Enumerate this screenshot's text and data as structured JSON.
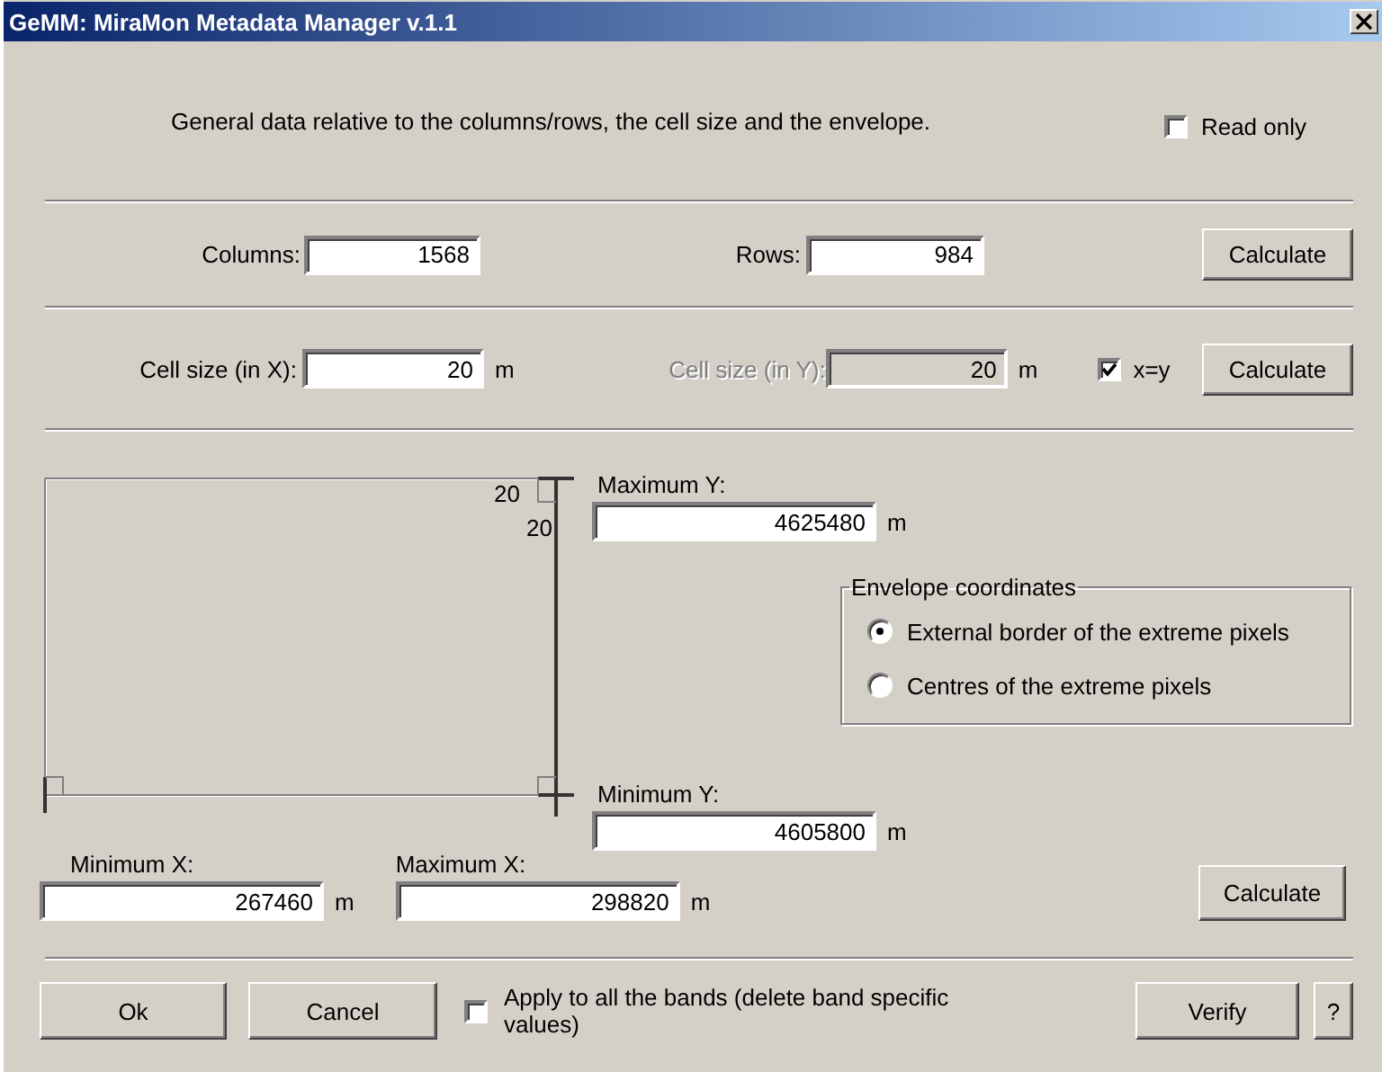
{
  "window": {
    "title": "GeMM: MiraMon Metadata Manager v.1.1"
  },
  "description": "General data relative to the columns/rows, the cell size and the envelope.",
  "read_only": {
    "label": "Read only",
    "checked": false
  },
  "dimensions": {
    "columns": {
      "label": "Columns:",
      "value": "1568"
    },
    "rows": {
      "label": "Rows:",
      "value": "984"
    },
    "calculate": "Calculate"
  },
  "cell_size": {
    "x": {
      "label": "Cell size (in X):",
      "value": "20",
      "unit": "m",
      "disabled": false
    },
    "y": {
      "label": "Cell size (in Y):",
      "value": "20",
      "unit": "m",
      "disabled": true
    },
    "x_equals_y": {
      "label": "x=y",
      "checked": true
    },
    "calculate": "Calculate"
  },
  "envelope": {
    "diagram_labels": [
      "20",
      "20"
    ],
    "max_y": {
      "label": "Maximum Y:",
      "value": "4625480",
      "unit": "m"
    },
    "min_y": {
      "label": "Minimum Y:",
      "value": "4605800",
      "unit": "m"
    },
    "min_x": {
      "label": "Minimum X:",
      "value": "267460",
      "unit": "m"
    },
    "max_x": {
      "label": "Maximum X:",
      "value": "298820",
      "unit": "m"
    },
    "coordinates": {
      "title": "Envelope coordinates",
      "options": [
        {
          "label": "External border of the extreme pixels",
          "selected": true
        },
        {
          "label": "Centres of the extreme pixels",
          "selected": false
        }
      ]
    },
    "calculate": "Calculate"
  },
  "footer": {
    "ok": "Ok",
    "cancel": "Cancel",
    "apply_all": {
      "label": "Apply to all the bands (delete band specific values)",
      "checked": false
    },
    "verify": "Verify",
    "help": "?"
  }
}
